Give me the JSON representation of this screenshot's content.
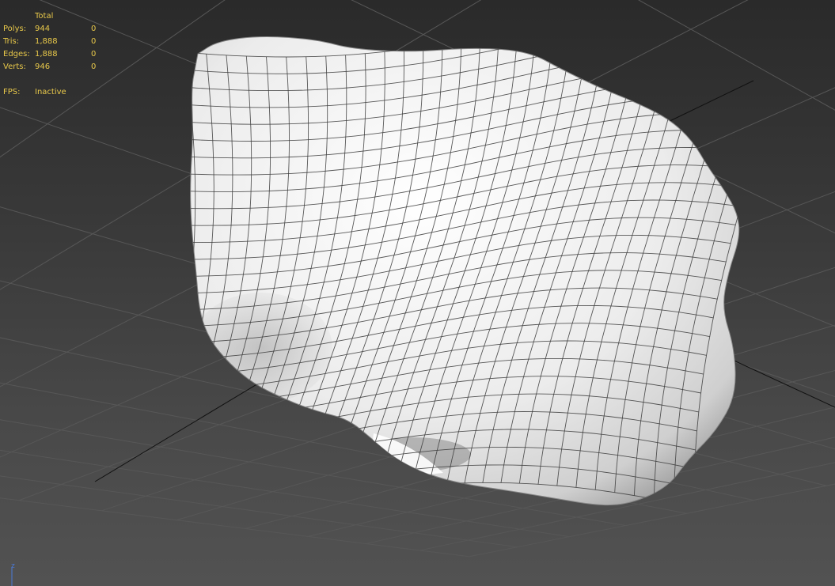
{
  "stats": {
    "header": "Total",
    "rows": [
      {
        "label": "Polys:",
        "total": "944",
        "selected": "0"
      },
      {
        "label": "Tris:",
        "total": "1,888",
        "selected": "0"
      },
      {
        "label": "Edges:",
        "total": "1,888",
        "selected": "0"
      },
      {
        "label": "Verts:",
        "total": "946",
        "selected": "0"
      }
    ],
    "fps_label": "FPS:",
    "fps_value": "Inactive"
  },
  "axis_gizmo": {
    "z_label": "z"
  },
  "colors": {
    "stats_text": "#e8c84a",
    "mesh_fill": "#f2f2f2",
    "wire": "#3c3c3c",
    "grid": "#575757",
    "axis_z": "#4a7ad8"
  },
  "viewport": {
    "object_icon": "rock-mesh",
    "grid_visible": true
  }
}
